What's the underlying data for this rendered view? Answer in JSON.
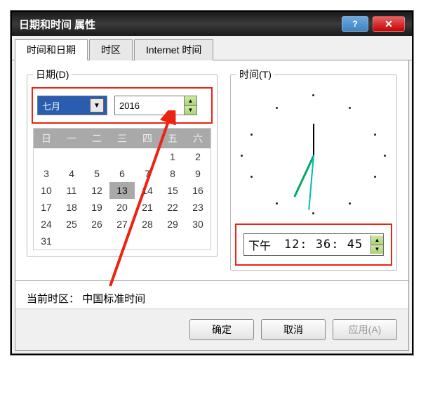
{
  "title": "日期和时间 属性",
  "tabs": {
    "t0": "时间和日期",
    "t1": "时区",
    "t2": "Internet 时间"
  },
  "date_group_label": "日期(D)",
  "time_group_label": "时间(T)",
  "month_selected": "七月",
  "year_value": "2016",
  "weekdays": {
    "d0": "日",
    "d1": "一",
    "d2": "二",
    "d3": "三",
    "d4": "四",
    "d5": "五",
    "d6": "六"
  },
  "calendar_rows": [
    [
      "",
      "",
      "",
      "",
      "",
      "1",
      "2"
    ],
    [
      "3",
      "4",
      "5",
      "6",
      "7",
      "8",
      "9"
    ],
    [
      "10",
      "11",
      "12",
      "13",
      "14",
      "15",
      "16"
    ],
    [
      "17",
      "18",
      "19",
      "20",
      "21",
      "22",
      "23"
    ],
    [
      "24",
      "25",
      "26",
      "27",
      "28",
      "29",
      "30"
    ],
    [
      "31",
      "",
      "",
      "",
      "",
      "",
      ""
    ]
  ],
  "today_cell": "13",
  "time_ampm": "下午",
  "time_value": "12: 36: 45",
  "timezone_label": "当前时区：",
  "timezone_value": "中国标准时间",
  "buttons": {
    "ok": "确定",
    "cancel": "取消",
    "apply": "应用(A)"
  }
}
